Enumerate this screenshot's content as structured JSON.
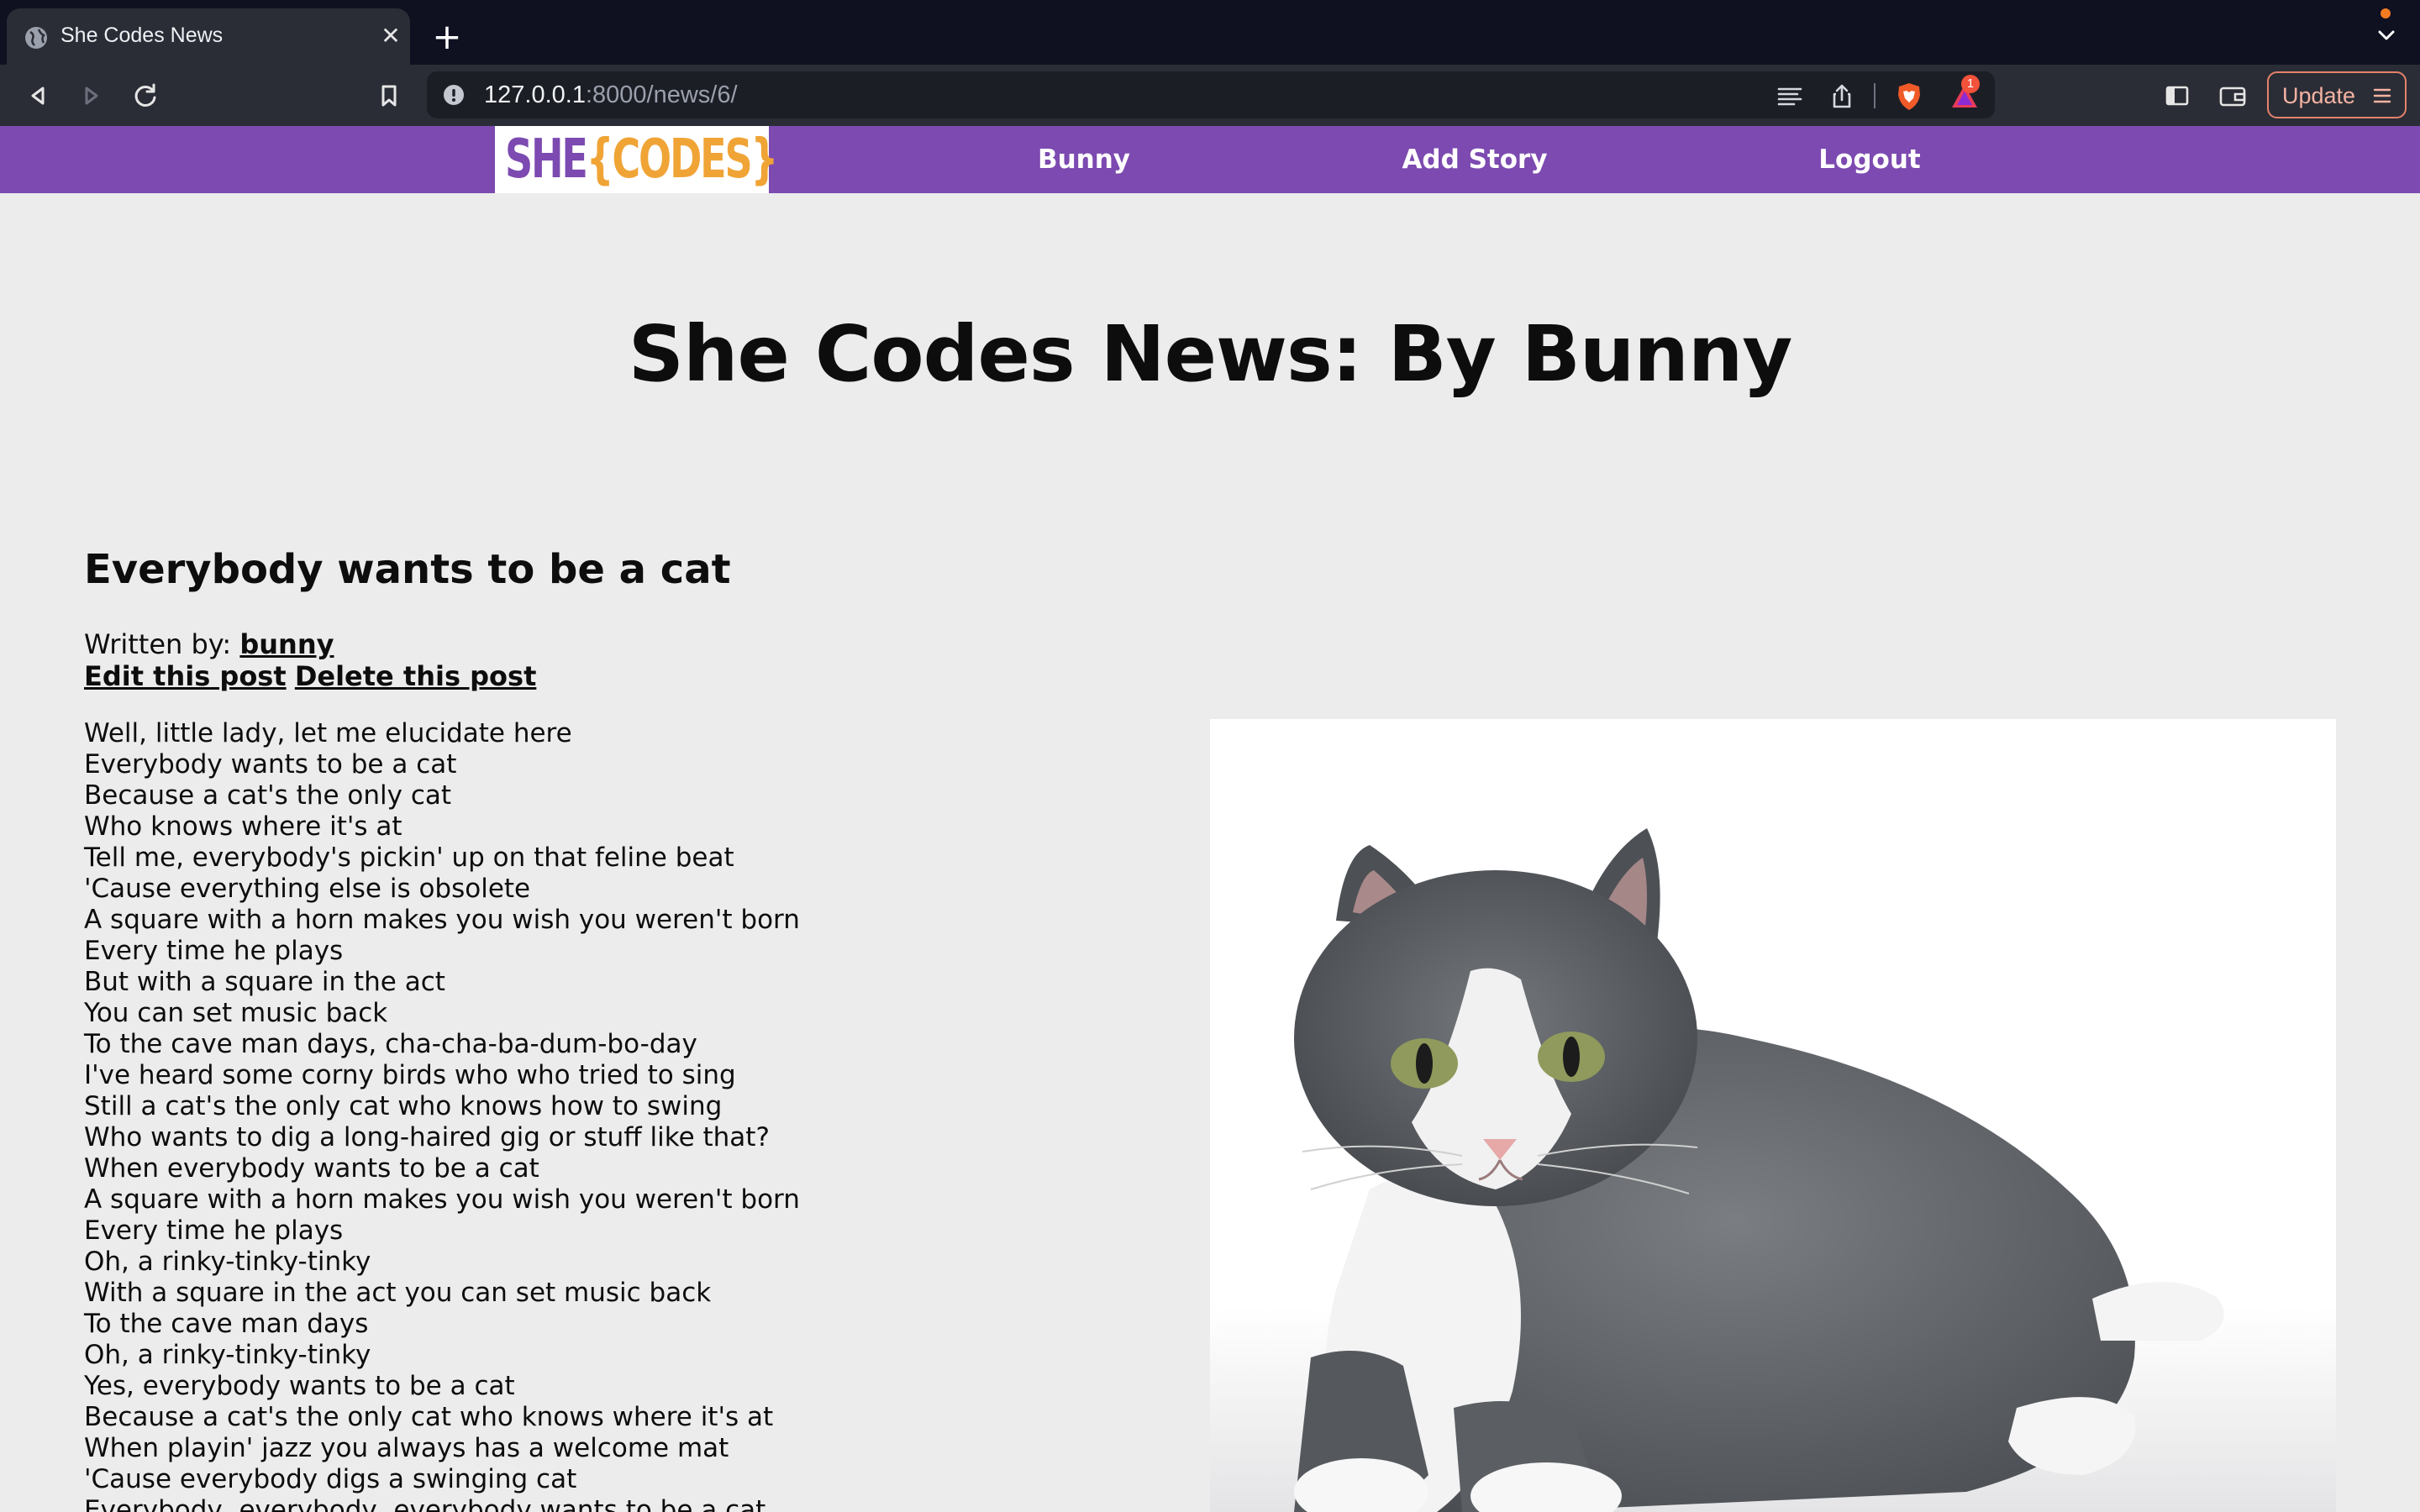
{
  "browser": {
    "tab_title": "She Codes News",
    "tab_close": "✕",
    "new_tab": "+",
    "url_host": "127.0.0.1",
    "url_path": ":8000/news/6/",
    "notification_count": "1",
    "update_label": "Update",
    "icons": [
      "globe-icon",
      "close-icon",
      "plus-icon",
      "chevron-down-icon",
      "back-icon",
      "forward-icon",
      "reload-icon",
      "bookmark-icon",
      "info-icon",
      "reader-mode-icon",
      "share-icon",
      "brave-shield-icon",
      "brave-rewards-icon",
      "sidebar-icon",
      "wallet-icon",
      "menu-icon"
    ]
  },
  "site": {
    "logo_she": "SHE",
    "logo_codes": "{CODES}",
    "nav": {
      "user": "Bunny",
      "add_story": "Add Story",
      "logout": "Logout"
    },
    "colors": {
      "nav_bg": "#7c4ab0",
      "logo_orange": "#f0a436",
      "page_bg": "#ececec"
    }
  },
  "page": {
    "title": "She Codes News: By Bunny"
  },
  "story": {
    "title": "Everybody wants to be a cat",
    "written_by_label": "Written by: ",
    "author": "bunny",
    "edit_link": "Edit this post",
    "delete_link": "Delete this post",
    "image": "cat-photo",
    "lines": [
      "Well, little lady, let me elucidate here",
      "Everybody wants to be a cat",
      "Because a cat's the only cat",
      "Who knows where it's at",
      "Tell me, everybody's pickin' up on that feline beat",
      "'Cause everything else is obsolete",
      "A square with a horn makes you wish you weren't born",
      "Every time he plays",
      "But with a square in the act",
      "You can set music back",
      "To the cave man days, cha-cha-ba-dum-bo-day",
      "I've heard some corny birds who who tried to sing",
      "Still a cat's the only cat who knows how to swing",
      "Who wants to dig a long-haired gig or stuff like that?",
      "When everybody wants to be a cat",
      "A square with a horn makes you wish you weren't born",
      "Every time he plays",
      "Oh, a rinky-tinky-tinky",
      "With a square in the act you can set music back",
      "To the cave man days",
      "Oh, a rinky-tinky-tinky",
      "Yes, everybody wants to be a cat",
      "Because a cat's the only cat who knows where it's at",
      "When playin' jazz you always has a welcome mat",
      "'Cause everybody digs a swinging cat",
      "Everybody, everybody, everybody wants to be a cat"
    ]
  }
}
